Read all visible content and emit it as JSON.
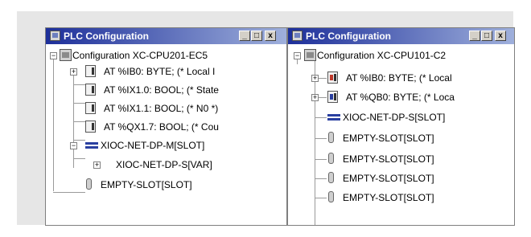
{
  "windows": [
    {
      "id": "w1",
      "title": "PLC Configuration",
      "controls": {
        "minimize": "_",
        "maximize": "□",
        "close": "x"
      },
      "tree": {
        "root": "Configuration XC-CPU201-EC5",
        "children": [
          {
            "label": "AT %IB0: BYTE; (* Local I",
            "icon": "module-icon"
          },
          {
            "label": "AT %IX1.0: BOOL; (* State",
            "icon": "module-icon"
          },
          {
            "label": "AT %IX1.1: BOOL; (* N0 *)",
            "icon": "module-icon"
          },
          {
            "label": "AT %QX1.7: BOOL; (* Cou",
            "icon": "module-icon"
          },
          {
            "label": "XIOC-NET-DP-M[SLOT]",
            "icon": "network-icon"
          },
          {
            "label": "XIOC-NET-DP-S[VAR]",
            "icon": "network-icon"
          },
          {
            "label": "EMPTY-SLOT[SLOT]",
            "icon": "slot-icon"
          }
        ]
      }
    },
    {
      "id": "w2",
      "title": "PLC Configuration",
      "controls": {
        "minimize": "_",
        "maximize": "□",
        "close": "x"
      },
      "tree": {
        "root": "Configuration XC-CPU101-C2",
        "children": [
          {
            "label": "AT %IB0: BYTE; (* Local",
            "icon": "module-icon"
          },
          {
            "label": "AT %QB0: BYTE; (* Loca",
            "icon": "module-icon"
          },
          {
            "label": "XIOC-NET-DP-S[SLOT]",
            "icon": "network-icon"
          },
          {
            "label": "EMPTY-SLOT[SLOT]",
            "icon": "slot-icon"
          },
          {
            "label": "EMPTY-SLOT[SLOT]",
            "icon": "slot-icon"
          },
          {
            "label": "EMPTY-SLOT[SLOT]",
            "icon": "slot-icon"
          },
          {
            "label": "EMPTY-SLOT[SLOT]",
            "icon": "slot-icon"
          }
        ]
      }
    }
  ],
  "colors": {
    "titlebar_start": "#1d2f9a",
    "titlebar_end": "#9fb0dc",
    "frame": "#e6e6e6"
  }
}
